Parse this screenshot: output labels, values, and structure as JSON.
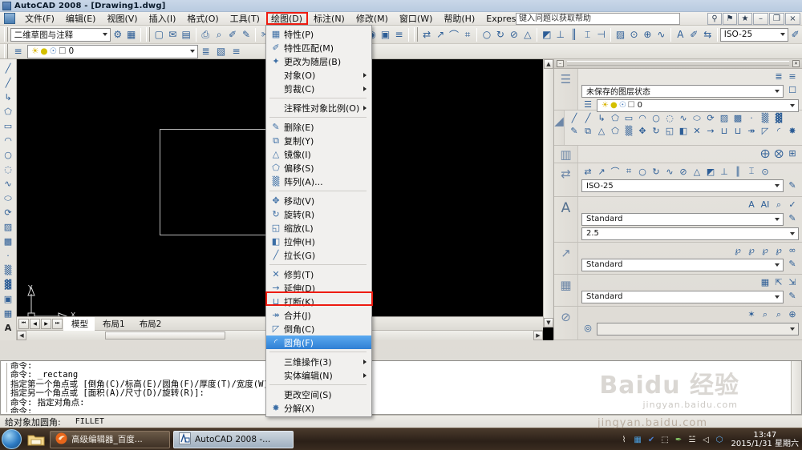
{
  "window": {
    "title": "AutoCAD 2008 - [Drawing1.dwg]",
    "app_icon": "autocad-icon",
    "minimize": "–",
    "maximize": "❐",
    "close": "×"
  },
  "menubar": {
    "items": [
      {
        "label": "文件(F)",
        "name": "menu-file"
      },
      {
        "label": "编辑(E)",
        "name": "menu-edit"
      },
      {
        "label": "视图(V)",
        "name": "menu-view"
      },
      {
        "label": "插入(I)",
        "name": "menu-insert"
      },
      {
        "label": "格式(O)",
        "name": "menu-format"
      },
      {
        "label": "工具(T)",
        "name": "menu-tools"
      },
      {
        "label": "绘图(D)",
        "name": "menu-draw"
      },
      {
        "label": "标注(N)",
        "name": "menu-dimension"
      },
      {
        "label": "修改(M)",
        "name": "menu-modify",
        "active": true
      },
      {
        "label": "窗口(W)",
        "name": "menu-window"
      },
      {
        "label": "帮助(H)",
        "name": "menu-help"
      },
      {
        "label": "Express",
        "name": "menu-express"
      }
    ],
    "help_search_placeholder": "键入问题以获取帮助",
    "search_icon": "⚲",
    "signin_icon": "⚑",
    "favorite_icon": "★"
  },
  "toolbar": {
    "workspace_value": "二维草图与注释",
    "workspace_buttons": [
      "⚙",
      "▦"
    ],
    "standard_icons": [
      "▢",
      "✉",
      "▤",
      "⎙",
      "⌕",
      "✐",
      "✎",
      "↶",
      "↷",
      "✂",
      "❐",
      "⌖",
      "⊞",
      "⌘",
      "◉",
      "▣",
      "≡"
    ],
    "dim_icons": [
      "⇄",
      "↗",
      "⌒",
      "⌗",
      "○",
      "↻",
      "⊘",
      "△",
      "◩",
      "⊥",
      "║",
      "⌶",
      "⊣",
      "▨",
      "⊙",
      "⊕",
      "∿",
      "A",
      "✐",
      "⇆"
    ],
    "dimstyle_value": "ISO-25"
  },
  "layerbar": {
    "layer_value": "0",
    "state_icons": [
      "☀",
      "●",
      "☉",
      "☐"
    ],
    "right_icons": [
      "≡",
      "≣",
      "▧"
    ]
  },
  "drawtoolbar": {
    "icons": [
      "╱",
      "╱",
      "↳",
      "⬠",
      "▭",
      "◠",
      "○",
      "◌",
      "∿",
      "⬭",
      "⟳",
      "▨",
      "▩",
      "·",
      "▒",
      "▓",
      "▣",
      "▦",
      "A"
    ]
  },
  "canvas": {
    "ucs_x_label": "X",
    "ucs_y_label": "Y",
    "shape": "rectangle"
  },
  "layout_tabs": {
    "nav": [
      "⏮",
      "◀",
      "▶",
      "⏭"
    ],
    "tabs": [
      {
        "label": "模型",
        "selected": true
      },
      {
        "label": "布局1",
        "selected": false
      },
      {
        "label": "布局2",
        "selected": false
      }
    ]
  },
  "dropdown_menu": {
    "name": "modify-menu",
    "items": [
      {
        "label": "特性(P)",
        "icon": "properties-icon",
        "glyph": "▦",
        "type": "item"
      },
      {
        "label": "特性匹配(M)",
        "icon": "match-properties-icon",
        "glyph": "✐",
        "type": "item"
      },
      {
        "label": "更改为随层(B)",
        "icon": "change-to-bylayer-icon",
        "glyph": "✦",
        "type": "item"
      },
      {
        "label": "对象(O)",
        "icon": "object-icon",
        "glyph": "",
        "type": "submenu"
      },
      {
        "label": "剪裁(C)",
        "icon": "clip-icon",
        "glyph": "",
        "type": "submenu"
      },
      {
        "type": "separator"
      },
      {
        "label": "注释性对象比例(O)",
        "icon": "annotative-scale-icon",
        "glyph": "",
        "type": "submenu"
      },
      {
        "type": "separator"
      },
      {
        "label": "删除(E)",
        "icon": "erase-icon",
        "glyph": "✎",
        "type": "item"
      },
      {
        "label": "复制(Y)",
        "icon": "copy-icon",
        "glyph": "⧉",
        "type": "item"
      },
      {
        "label": "镜像(I)",
        "icon": "mirror-icon",
        "glyph": "△",
        "type": "item"
      },
      {
        "label": "偏移(S)",
        "icon": "offset-icon",
        "glyph": "⬠",
        "type": "item"
      },
      {
        "label": "阵列(A)...",
        "icon": "array-icon",
        "glyph": "▒",
        "type": "item"
      },
      {
        "type": "separator"
      },
      {
        "label": "移动(V)",
        "icon": "move-icon",
        "glyph": "✥",
        "type": "item"
      },
      {
        "label": "旋转(R)",
        "icon": "rotate-icon",
        "glyph": "↻",
        "type": "item"
      },
      {
        "label": "缩放(L)",
        "icon": "scale-icon",
        "glyph": "◱",
        "type": "item"
      },
      {
        "label": "拉伸(H)",
        "icon": "stretch-icon",
        "glyph": "◧",
        "type": "item"
      },
      {
        "label": "拉长(G)",
        "icon": "lengthen-icon",
        "glyph": "╱",
        "type": "item"
      },
      {
        "type": "separator"
      },
      {
        "label": "修剪(T)",
        "icon": "trim-icon",
        "glyph": "✕",
        "type": "item"
      },
      {
        "label": "延伸(D)",
        "icon": "extend-icon",
        "glyph": "→",
        "type": "item"
      },
      {
        "label": "打断(K)",
        "icon": "break-icon",
        "glyph": "⊔",
        "type": "item"
      },
      {
        "label": "合并(J)",
        "icon": "join-icon",
        "glyph": "↠",
        "type": "item"
      },
      {
        "label": "倒角(C)",
        "icon": "chamfer-icon",
        "glyph": "◸",
        "type": "item"
      },
      {
        "label": "圆角(F)",
        "icon": "fillet-icon",
        "glyph": "◜",
        "type": "item",
        "highlight": true
      },
      {
        "type": "separator"
      },
      {
        "label": "三维操作(3)",
        "icon": "3d-operation-icon",
        "glyph": "",
        "type": "submenu"
      },
      {
        "label": "实体编辑(N)",
        "icon": "solid-editing-icon",
        "glyph": "",
        "type": "submenu"
      },
      {
        "type": "separator"
      },
      {
        "label": "更改空间(S)",
        "icon": "change-space-icon",
        "glyph": "",
        "type": "item"
      },
      {
        "label": "分解(X)",
        "icon": "explode-icon",
        "glyph": "✸",
        "type": "item"
      }
    ]
  },
  "dashboard": {
    "title_close": "✕",
    "title_min": "–",
    "panels": [
      {
        "name": "layers-panel",
        "icon": "layers-icon",
        "icon_glyph": "☰",
        "top_icons": [
          "≣",
          "≡"
        ],
        "combo1_value": "未保存的图层状态",
        "combo2_value": "0",
        "layer_state_icons": [
          "☀",
          "●",
          "☉",
          "☐"
        ]
      },
      {
        "name": "2d-draw-panel",
        "icon": "draw-2d-icon",
        "icon_glyph": "◢",
        "row1": [
          "╱",
          "╱",
          "↳",
          "⬠",
          "▭",
          "◠",
          "○",
          "◌",
          "∿",
          "⬭",
          "⟳",
          "▨",
          "▩",
          "·",
          "▒",
          "▓"
        ],
        "row2": [
          "✎",
          "⧉",
          "△",
          "⬠",
          "▒",
          "✥",
          "↻",
          "◱",
          "◧",
          "✕",
          "→",
          "⊔",
          "⊔",
          "↠",
          "◸",
          "◜",
          "✸"
        ]
      },
      {
        "name": "annotation-scaling-panel",
        "icon": "annotation-scale-icon",
        "icon_glyph": "▥",
        "icons": [
          "⨁",
          "⨂",
          "⊞"
        ]
      },
      {
        "name": "dimensions-panel",
        "icon": "dimension-icon",
        "icon_glyph": "⇄",
        "icons": [
          "⇄",
          "↗",
          "⌒",
          "⌗",
          "○",
          "↻",
          "∿",
          "⊘",
          "△",
          "◩",
          "⊥",
          "║",
          "⌶",
          "⊙"
        ],
        "combo_value": "ISO-25"
      },
      {
        "name": "text-panel",
        "icon": "text-icon",
        "icon_glyph": "A",
        "icons": [
          "A",
          "AI",
          "⌕",
          "✓"
        ],
        "style_value": "Standard",
        "height_value": "2.5"
      },
      {
        "name": "multileader-panel",
        "icon": "multileader-icon",
        "icon_glyph": "↗",
        "icons": [
          "℘",
          "℘",
          "℘",
          "℘",
          "∞"
        ],
        "style_value": "Standard"
      },
      {
        "name": "tables-panel",
        "icon": "table-icon",
        "icon_glyph": "▦",
        "icons": [
          "▦",
          "⇱",
          "⇲"
        ],
        "style_value": "Standard"
      },
      {
        "name": "2d-navigate-panel",
        "icon": "navigate-icon",
        "icon_glyph": "⊘",
        "icons": [
          "✶",
          "⌕",
          "⌕",
          "⊕"
        ],
        "combo_value": ""
      }
    ]
  },
  "command_window": {
    "lines": [
      "命令:",
      "命令: _rectang",
      "指定第一个角点或 [倒角(C)/标高(E)/圆角(F)/厚度(T)/宽度(W)]:",
      "指定另一个角点或 [面积(A)/尺寸(D)/旋转(R)]:",
      "命令: 指定对角点:",
      "命令:"
    ]
  },
  "statusbar": {
    "prompt": "给对象加圆角:",
    "command": "FILLET"
  },
  "taskbar": {
    "start_icon": "windows-orb-icon",
    "quick_launch": [
      "folder-icon"
    ],
    "items": [
      {
        "label": "高级编辑器_百度...",
        "icon": "firefox-icon",
        "selected": false
      },
      {
        "label": "AutoCAD 2008 -...",
        "icon": "autocad-icon",
        "selected": true
      }
    ],
    "tray_icons": [
      "⌇",
      "▦",
      "✔",
      "⬚",
      "✒",
      "☱",
      "◁",
      "⬡"
    ],
    "time": "13:47",
    "date": "2015/1/31 星期六"
  },
  "watermark": {
    "line1": "Baidu 经验",
    "line2": "jingyan.baidu.com"
  },
  "colors": {
    "highlight": "#2f7fd4",
    "red_box": "#ee1b10",
    "canvas_bg": "#000000",
    "panel_bg": "#e9e7e2"
  }
}
